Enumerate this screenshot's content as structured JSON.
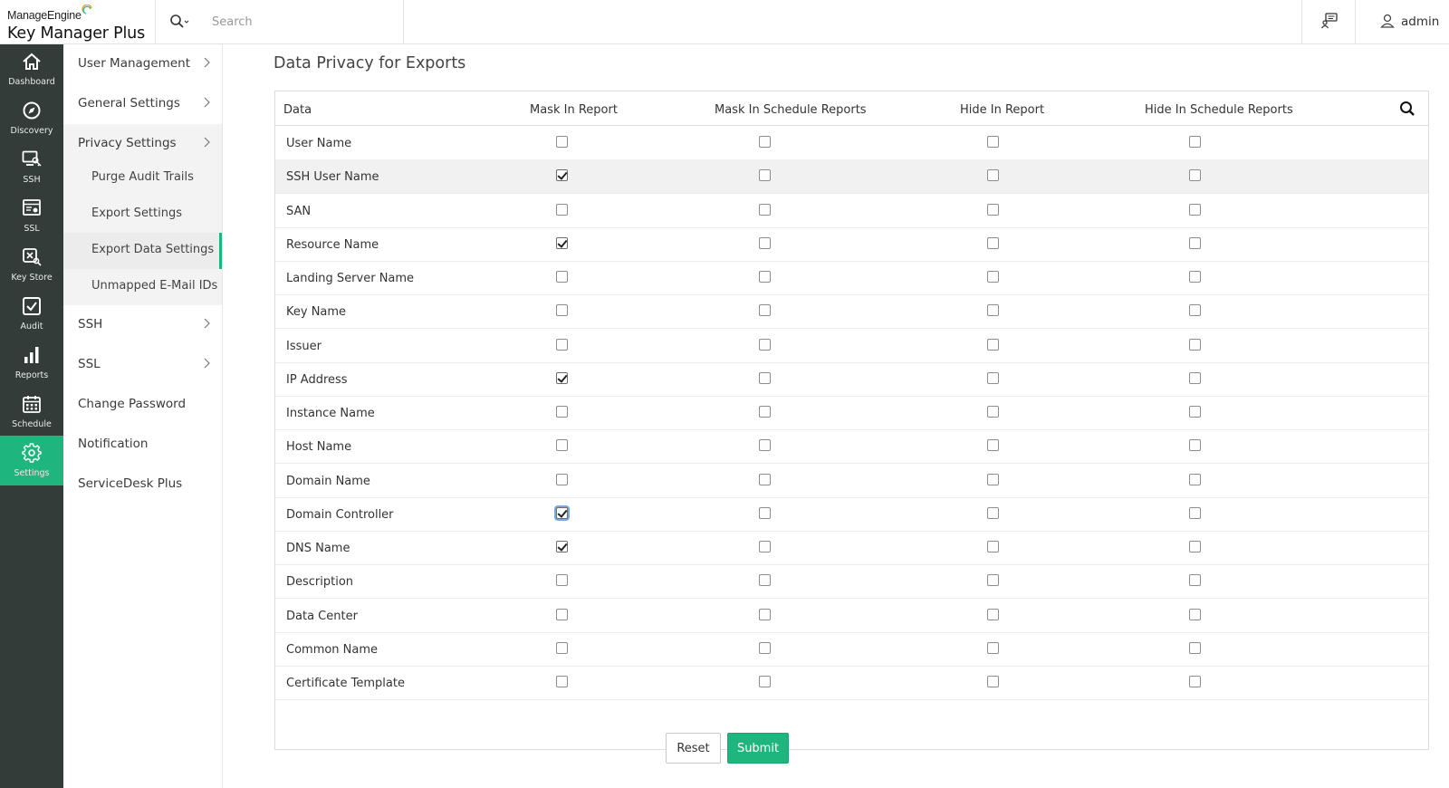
{
  "app": {
    "brand": "ManageEngine",
    "product": "Key Manager Plus",
    "colors": {
      "accent": "#1fb57e",
      "rail_bg": "#343c3a"
    }
  },
  "search": {
    "placeholder": "Search"
  },
  "header": {
    "user": "admin",
    "announce_icon": "announcement-icon",
    "user_icon": "user-icon"
  },
  "rail": {
    "items": [
      {
        "label": "Dashboard",
        "icon": "home-icon"
      },
      {
        "label": "Discovery",
        "icon": "discovery-icon"
      },
      {
        "label": "SSH",
        "icon": "ssh-icon"
      },
      {
        "label": "SSL",
        "icon": "ssl-icon"
      },
      {
        "label": "Key Store",
        "icon": "key-store-icon"
      },
      {
        "label": "Audit",
        "icon": "audit-icon"
      },
      {
        "label": "Reports",
        "icon": "reports-icon"
      },
      {
        "label": "Schedule",
        "icon": "calendar-icon"
      },
      {
        "label": "Settings",
        "icon": "gear-icon",
        "active": true
      }
    ]
  },
  "submenu": {
    "user_management": "User Management",
    "general_settings": "General Settings",
    "privacy_settings": "Privacy Settings",
    "purge_audit_trails": "Purge Audit Trails",
    "export_settings": "Export Settings",
    "export_data_settings": "Export Data Settings",
    "unmapped_email_ids": "Unmapped E-Mail IDs",
    "ssh": "SSH",
    "ssl": "SSL",
    "change_password": "Change Password",
    "notification": "Notification",
    "servicedesk_plus": "ServiceDesk Plus",
    "active": "Export Data Settings"
  },
  "main": {
    "title": "Data Privacy for Exports",
    "columns": [
      "Data",
      "Mask In Report",
      "Mask In Schedule Reports",
      "Hide In Report",
      "Hide In Schedule Reports"
    ],
    "rows": [
      {
        "label": "User Name",
        "mask_report": false,
        "mask_schedule": false,
        "hide_report": false,
        "hide_schedule": false
      },
      {
        "label": "SSH User Name",
        "mask_report": true,
        "mask_schedule": false,
        "hide_report": false,
        "hide_schedule": false,
        "highlighted": true
      },
      {
        "label": "SAN",
        "mask_report": false,
        "mask_schedule": false,
        "hide_report": false,
        "hide_schedule": false
      },
      {
        "label": "Resource Name",
        "mask_report": true,
        "mask_schedule": false,
        "hide_report": false,
        "hide_schedule": false
      },
      {
        "label": "Landing Server Name",
        "mask_report": false,
        "mask_schedule": false,
        "hide_report": false,
        "hide_schedule": false
      },
      {
        "label": "Key Name",
        "mask_report": false,
        "mask_schedule": false,
        "hide_report": false,
        "hide_schedule": false
      },
      {
        "label": "Issuer",
        "mask_report": false,
        "mask_schedule": false,
        "hide_report": false,
        "hide_schedule": false
      },
      {
        "label": "IP Address",
        "mask_report": true,
        "mask_schedule": false,
        "hide_report": false,
        "hide_schedule": false
      },
      {
        "label": "Instance Name",
        "mask_report": false,
        "mask_schedule": false,
        "hide_report": false,
        "hide_schedule": false
      },
      {
        "label": "Host Name",
        "mask_report": false,
        "mask_schedule": false,
        "hide_report": false,
        "hide_schedule": false
      },
      {
        "label": "Domain Name",
        "mask_report": false,
        "mask_schedule": false,
        "hide_report": false,
        "hide_schedule": false
      },
      {
        "label": "Domain Controller",
        "mask_report": true,
        "mask_schedule": false,
        "hide_report": false,
        "hide_schedule": false,
        "focused": true
      },
      {
        "label": "DNS Name",
        "mask_report": true,
        "mask_schedule": false,
        "hide_report": false,
        "hide_schedule": false
      },
      {
        "label": "Description",
        "mask_report": false,
        "mask_schedule": false,
        "hide_report": false,
        "hide_schedule": false
      },
      {
        "label": "Data Center",
        "mask_report": false,
        "mask_schedule": false,
        "hide_report": false,
        "hide_schedule": false
      },
      {
        "label": "Common Name",
        "mask_report": false,
        "mask_schedule": false,
        "hide_report": false,
        "hide_schedule": false
      },
      {
        "label": "Certificate Template",
        "mask_report": false,
        "mask_schedule": false,
        "hide_report": false,
        "hide_schedule": false
      }
    ]
  },
  "actions": {
    "reset": "Reset",
    "submit": "Submit"
  }
}
